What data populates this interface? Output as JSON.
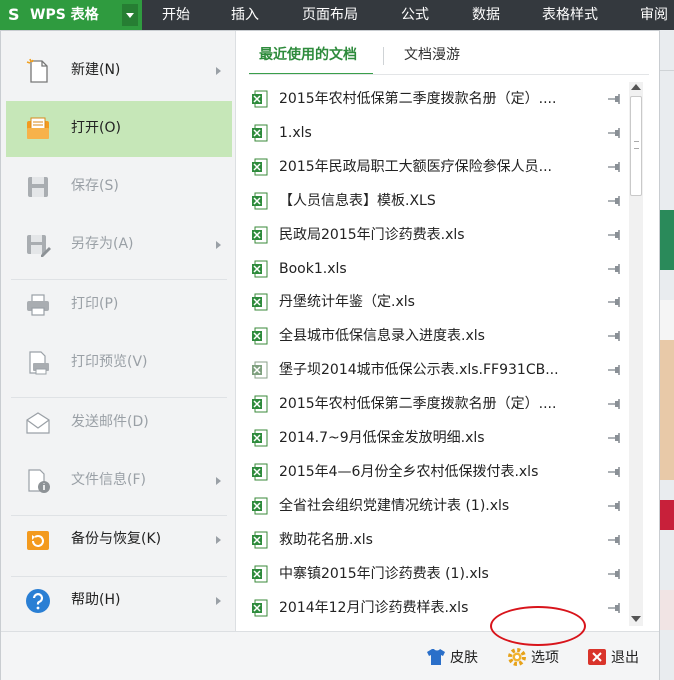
{
  "app": {
    "logo": "S",
    "title": "WPS 表格"
  },
  "ribbon": {
    "tabs": [
      "开始",
      "插入",
      "页面布局",
      "公式",
      "数据",
      "表格样式",
      "审阅"
    ]
  },
  "menu": {
    "items": [
      {
        "label": "新建(N)",
        "icon": "new-file-icon",
        "state": "normal",
        "submenu": true
      },
      {
        "label": "打开(O)",
        "icon": "open-folder-icon",
        "state": "active",
        "submenu": false
      },
      {
        "label": "保存(S)",
        "icon": "save-icon",
        "state": "disabled",
        "submenu": false
      },
      {
        "label": "另存为(A)",
        "icon": "save-as-icon",
        "state": "disabled",
        "submenu": true
      },
      {
        "label": "打印(P)",
        "icon": "print-icon",
        "state": "disabled",
        "submenu": false
      },
      {
        "label": "打印预览(V)",
        "icon": "print-preview-icon",
        "state": "disabled",
        "submenu": false
      },
      {
        "label": "发送邮件(D)",
        "icon": "mail-icon",
        "state": "disabled",
        "submenu": false
      },
      {
        "label": "文件信息(F)",
        "icon": "file-info-icon",
        "state": "disabled",
        "submenu": true
      },
      {
        "label": "备份与恢复(K)",
        "icon": "backup-restore-icon",
        "state": "normal",
        "submenu": true
      },
      {
        "label": "帮助(H)",
        "icon": "help-icon",
        "state": "normal",
        "submenu": true
      }
    ]
  },
  "tabs": {
    "recent": "最近使用的文档",
    "roaming": "文档漫游"
  },
  "files": [
    "2015年农村低保第二季度拨款名册（定）....",
    "1.xls",
    "2015年民政局职工大额医疗保险参保人员...",
    "【人员信息表】模板.XLS",
    "民政局2015年门诊药费表.xls",
    "Book1.xls",
    "丹堡统计年鉴（定.xls",
    "全县城市低保信息录入进度表.xls",
    "堡子坝2014城市低保公示表.xls.FF931CB...",
    "2015年农村低保第二季度拨款名册（定）....",
    "2014.7~9月低保金发放明细.xls",
    "2015年4—6月份全乡农村低保拨付表.xls",
    "全省社会组织党建情况统计表 (1).xls",
    "救助花名册.xls",
    "中寨镇2015年门诊药费表 (1).xls",
    "2014年12月门诊药费样表.xls"
  ],
  "bottom": {
    "skin": "皮肤",
    "options": "选项",
    "exit": "退出"
  },
  "colors": {
    "brand_green": "#2f9b3f",
    "active_item": "#c6e7b8",
    "highlight_circle": "#d8141b",
    "topbar": "#34393e"
  }
}
